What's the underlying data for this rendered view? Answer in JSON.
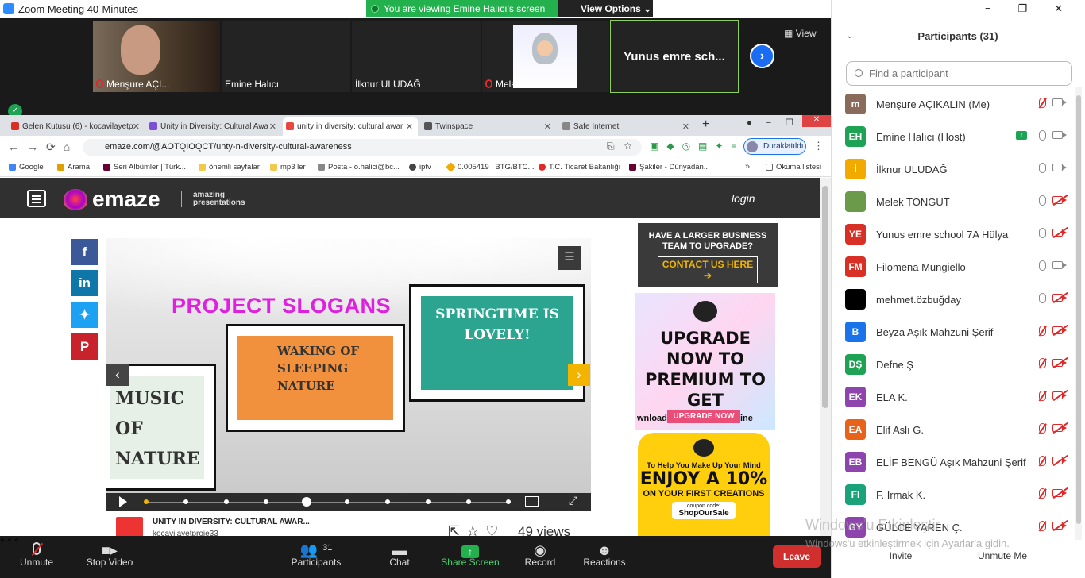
{
  "window": {
    "title": "Zoom Meeting 40-Minutes"
  },
  "banner": {
    "viewing": "You are viewing Emine Halıcı's screen",
    "view_options": "View Options ⌄"
  },
  "strip": {
    "view_label": "View",
    "thumbs": [
      {
        "name": "Menşure AÇI..."
      },
      {
        "name": "Emine Halıcı"
      },
      {
        "name": "İlknur ULUDAĞ"
      },
      {
        "name": "Melahat Yıldı..."
      }
    ],
    "big_name": "Yunus emre sch..."
  },
  "browser": {
    "tabs": [
      {
        "label": "Gelen Kutusu (6) - kocavilayetp",
        "color": "#d93025"
      },
      {
        "label": "Unity in Diversity: Cultural Awa",
        "color": "#7b4fd6"
      },
      {
        "label": "unity in diversity: cultural awar",
        "color": "#e8483f"
      },
      {
        "label": "Twinspace",
        "color": "#555555"
      },
      {
        "label": "Safe Internet",
        "color": "#888888"
      }
    ],
    "url": "emaze.com/@AOTQIOQCT/unty-n-diversity-cultural-awareness",
    "paused": "Duraklatıldı",
    "bookmarks": [
      {
        "label": "Google",
        "color": "#4285f4"
      },
      {
        "label": "Arama",
        "color": "#e0a000"
      },
      {
        "label": "Seri Albümler | Türk...",
        "color": "#660033"
      },
      {
        "label": "önemli sayfalar",
        "color": "#f2c94c"
      },
      {
        "label": "mp3 ler",
        "color": "#f2c94c"
      },
      {
        "label": "Posta - o.halici@bc...",
        "color": "#888888"
      },
      {
        "label": "iptv",
        "color": "#444444"
      },
      {
        "label": "0.005419 | BTG/BTC...",
        "color": "#f2a900"
      },
      {
        "label": "T.C. Ticaret Bakanlığı",
        "color": "#e02828"
      },
      {
        "label": "Şakiler - Dünyadan...",
        "color": "#660033"
      },
      {
        "label": "Okuma listesi",
        "color": "#666666"
      }
    ]
  },
  "emaze": {
    "logo": "emaze",
    "tag1": "amazing",
    "tag2": "presentations",
    "login": "login",
    "slide_title": "PROJECT SLOGANS",
    "frame1": "WAKING OF SLEEPING NATURE",
    "frame2": "SPRINGTIME IS LOVELY!",
    "frame3": "MUSIC OF NATURE",
    "pres_title": "UNITY IN DIVERSITY: CULTURAL AWAR...",
    "author": "kocavilayetproje33",
    "views": "49 views"
  },
  "ads": {
    "ad1_text": "HAVE A LARGER BUSINESS TEAM TO UPGRADE?",
    "ad1_btn": "CONTACT US HERE ➔",
    "ad2_head": "UPGRADE NOW TO PREMIUM TO GET",
    "ad2_sub": "wnloads to PDF, IL & Offline",
    "ad2_btn": "UPGRADE NOW",
    "ad3_sub": "To Help You Make Up Your Mind",
    "ad3_head": "ENJOY A 10%",
    "ad3_sub2": "ON YOUR FIRST CREATIONS",
    "ad3_code_label": "coupon code:",
    "ad3_code": "ShopOurSale"
  },
  "toolbar": {
    "unmute": "Unmute",
    "stop_video": "Stop Video",
    "participants": "Participants",
    "participants_count": "31",
    "chat": "Chat",
    "share_screen": "Share Screen",
    "record": "Record",
    "reactions": "Reactions",
    "leave": "Leave"
  },
  "panel": {
    "title": "Participants (31)",
    "search_placeholder": "Find a participant",
    "participants": [
      {
        "initials": "m",
        "name": "Menşure AÇIKALIN (Me)",
        "color": "#8a6a5a",
        "mic": "off",
        "cam": "on"
      },
      {
        "initials": "EH",
        "name": "Emine Halıcı (Host)",
        "color": "#1ea355",
        "mic": "on",
        "cam": "on"
      },
      {
        "initials": "İ",
        "name": "İlknur ULUDAĞ",
        "color": "#f2a900",
        "mic": "on",
        "cam": "on"
      },
      {
        "initials": "",
        "name": "Melek TONGUT",
        "color": "#6a9a4a",
        "mic": "on",
        "cam": "off"
      },
      {
        "initials": "YE",
        "name": "Yunus emre school 7A Hülya",
        "color": "#d93025",
        "mic": "on",
        "cam": "off"
      },
      {
        "initials": "FM",
        "name": "Filomena Mungiello",
        "color": "#d93025",
        "mic": "on",
        "cam": "on"
      },
      {
        "initials": "",
        "name": "mehmet.özbuğday",
        "color": "#000000",
        "mic": "on",
        "cam": "off"
      },
      {
        "initials": "B",
        "name": "Beyza Aşık Mahzuni Şerif",
        "color": "#1a73e8",
        "mic": "off",
        "cam": "off"
      },
      {
        "initials": "DŞ",
        "name": "Defne Ş",
        "color": "#1ea355",
        "mic": "off",
        "cam": "off"
      },
      {
        "initials": "EK",
        "name": "ELA K.",
        "color": "#8e44ad",
        "mic": "off",
        "cam": "off"
      },
      {
        "initials": "EA",
        "name": "Elif Aslı G.",
        "color": "#e8631a",
        "mic": "off",
        "cam": "off"
      },
      {
        "initials": "EB",
        "name": "ELİF BENGÜ Aşık Mahzuni Şerif",
        "color": "#8e44ad",
        "mic": "off",
        "cam": "off"
      },
      {
        "initials": "FI",
        "name": "F. Irmak K.",
        "color": "#1aa37a",
        "mic": "off",
        "cam": "off"
      },
      {
        "initials": "GY",
        "name": "GÜLCE YAREN Ç.",
        "color": "#8e44ad",
        "mic": "off",
        "cam": "off"
      }
    ],
    "invite": "Invite",
    "unmute_me": "Unmute Me"
  },
  "watermark": {
    "line1": "Windows'u Etkinleştir",
    "line2": "Windows'u etkinleştirmek için Ayarlar'a gidin."
  }
}
